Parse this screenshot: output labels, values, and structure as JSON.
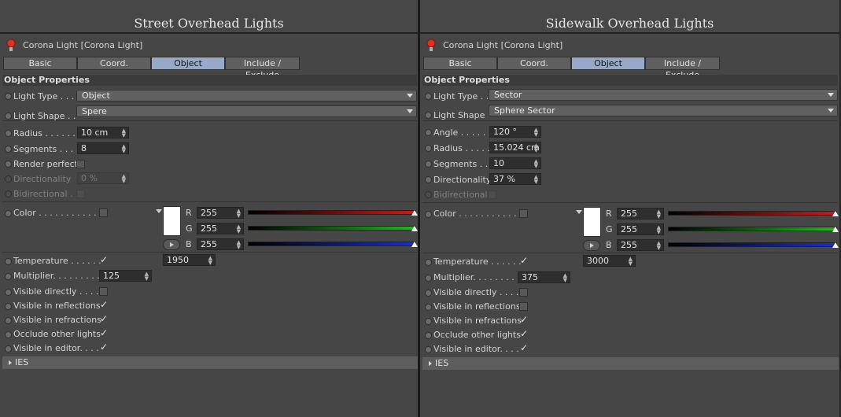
{
  "panels": [
    {
      "title": "Street Overhead Lights",
      "object_name": "Corona Light [Corona Light]",
      "tabs": [
        {
          "label": "Basic",
          "active": false
        },
        {
          "label": "Coord.",
          "active": false
        },
        {
          "label": "Object",
          "active": true
        },
        {
          "label": "Include / Exclude",
          "active": false
        }
      ],
      "section_title": "Object Properties",
      "light_type_label": "Light Type . . .",
      "light_type_value": "Object",
      "light_shape_label": "Light Shape . .",
      "light_shape_value": "Spere",
      "params": [
        {
          "label": "Radius . . . . . .",
          "value": "10 cm",
          "dim": false
        },
        {
          "label": "Segments . . . .",
          "value": "8",
          "dim": false
        },
        {
          "label": "Render perfect",
          "checkbox": true,
          "checked": false,
          "dim": false
        },
        {
          "label": "Directionality",
          "value": "0 %",
          "dim": true
        },
        {
          "label": "Bidirectional .",
          "checkbox": true,
          "checked": false,
          "dim": true
        }
      ],
      "color_label": "Color . . . . . . . . . . . .",
      "rgb": {
        "r_label": "R",
        "r": "255",
        "g_label": "G",
        "g": "255",
        "b_label": "B",
        "b": "255"
      },
      "temperature_label": "Temperature . . . . . .",
      "temperature_checked": true,
      "temperature_value": "1950",
      "multiplier_label": "Multiplier. . . . . . . . .",
      "multiplier_value": "125",
      "visibility": [
        {
          "label": "Visible directly . . . . .",
          "checked": false
        },
        {
          "label": "Visible in reflections",
          "checked": true
        },
        {
          "label": "Visible in refractions",
          "checked": true
        },
        {
          "label": "Occlude other lights",
          "checked": true
        },
        {
          "label": "Visible in editor. . . .",
          "checked": true
        }
      ],
      "ies_label": "IES"
    },
    {
      "title": "Sidewalk Overhead Lights",
      "object_name": "Corona Light [Corona Light]",
      "tabs": [
        {
          "label": "Basic",
          "active": false
        },
        {
          "label": "Coord.",
          "active": false
        },
        {
          "label": "Object",
          "active": true
        },
        {
          "label": "Include / Exclude",
          "active": false
        }
      ],
      "section_title": "Object Properties",
      "light_type_label": "Light Type . .",
      "light_type_value": "Sector",
      "light_shape_label": "Light Shape",
      "light_shape_value": "Sphere Sector",
      "params": [
        {
          "label": "Angle . . . . . . .",
          "value": "120 °",
          "dim": false
        },
        {
          "label": "Radius . . . . .",
          "value": "15.024 cm",
          "dim": false
        },
        {
          "label": "Segments . . .",
          "value": "10",
          "dim": false
        },
        {
          "label": "Directionality",
          "value": "37 %",
          "dim": false
        },
        {
          "label": "Bidirectional",
          "checkbox": true,
          "checked": false,
          "dim": true
        }
      ],
      "color_label": "Color . . . . . . . . . . . .",
      "rgb": {
        "r_label": "R",
        "r": "255",
        "g_label": "G",
        "g": "255",
        "b_label": "B",
        "b": "255"
      },
      "temperature_label": "Temperature . . . . . .",
      "temperature_checked": true,
      "temperature_value": "3000",
      "multiplier_label": "Multiplier. . . . . . . . .",
      "multiplier_value": "375",
      "visibility": [
        {
          "label": "Visible directly . . . . .",
          "checked": false
        },
        {
          "label": "Visible in reflections",
          "checked": false
        },
        {
          "label": "Visible in refractions",
          "checked": true
        },
        {
          "label": "Occlude other lights",
          "checked": true
        },
        {
          "label": "Visible in editor. . . .",
          "checked": true
        }
      ],
      "ies_label": "IES"
    }
  ],
  "colors": {
    "red": "#d01818",
    "green": "#18c018",
    "blue": "#1830d0",
    "tab_active": "#96a9c8"
  },
  "icons": {
    "light": "light-bulb-icon",
    "check": "checkmark-icon"
  }
}
